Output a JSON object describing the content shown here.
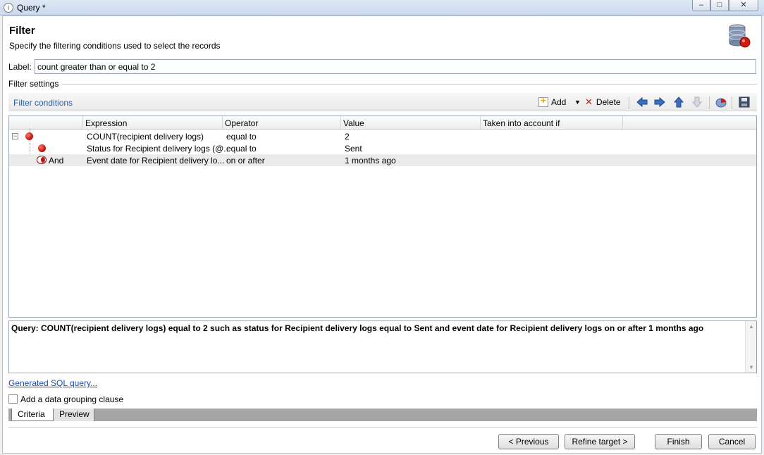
{
  "window": {
    "title": "Query *",
    "controls": {
      "minimize": "–",
      "maximize": "□",
      "close": "✕"
    }
  },
  "header": {
    "title": "Filter",
    "subtitle": "Specify the filtering conditions used to select the records",
    "icon": "database-icon"
  },
  "label_field": {
    "label": "Label:",
    "value": "count greater than or equal to 2"
  },
  "filter_settings": {
    "title": "Filter settings",
    "conditions_title": "Filter conditions",
    "toolbar": {
      "add": "Add",
      "delete": "Delete"
    },
    "columns": [
      "Expression",
      "Operator",
      "Value",
      "Taken into account if"
    ],
    "rows": [
      {
        "logic": "",
        "expression": "COUNT(recipient delivery logs)",
        "operator": "equal to",
        "value": "2",
        "taken": ""
      },
      {
        "logic": "",
        "expression": "Status for Recipient delivery logs (@...",
        "operator": "equal to",
        "value": "Sent",
        "taken": ""
      },
      {
        "logic": "And",
        "expression": "Event date for Recipient delivery lo...",
        "operator": "on or after",
        "value": "1 months ago",
        "taken": ""
      }
    ]
  },
  "query_text": "Query: COUNT(recipient delivery logs) equal to 2 such as status for Recipient delivery logs equal to Sent and event date for Recipient delivery logs on or after 1 months ago",
  "links": {
    "sql": "Generated SQL query..."
  },
  "grouping": {
    "label": "Add a data grouping clause",
    "checked": false
  },
  "tabs": [
    "Criteria",
    "Preview"
  ],
  "buttons": {
    "previous": "< Previous",
    "refine": "Refine target >",
    "finish": "Finish",
    "cancel": "Cancel"
  },
  "colors": {
    "link": "#1a4fb0",
    "accent_red": "#c4150c",
    "section_title": "#2b5fa8"
  }
}
